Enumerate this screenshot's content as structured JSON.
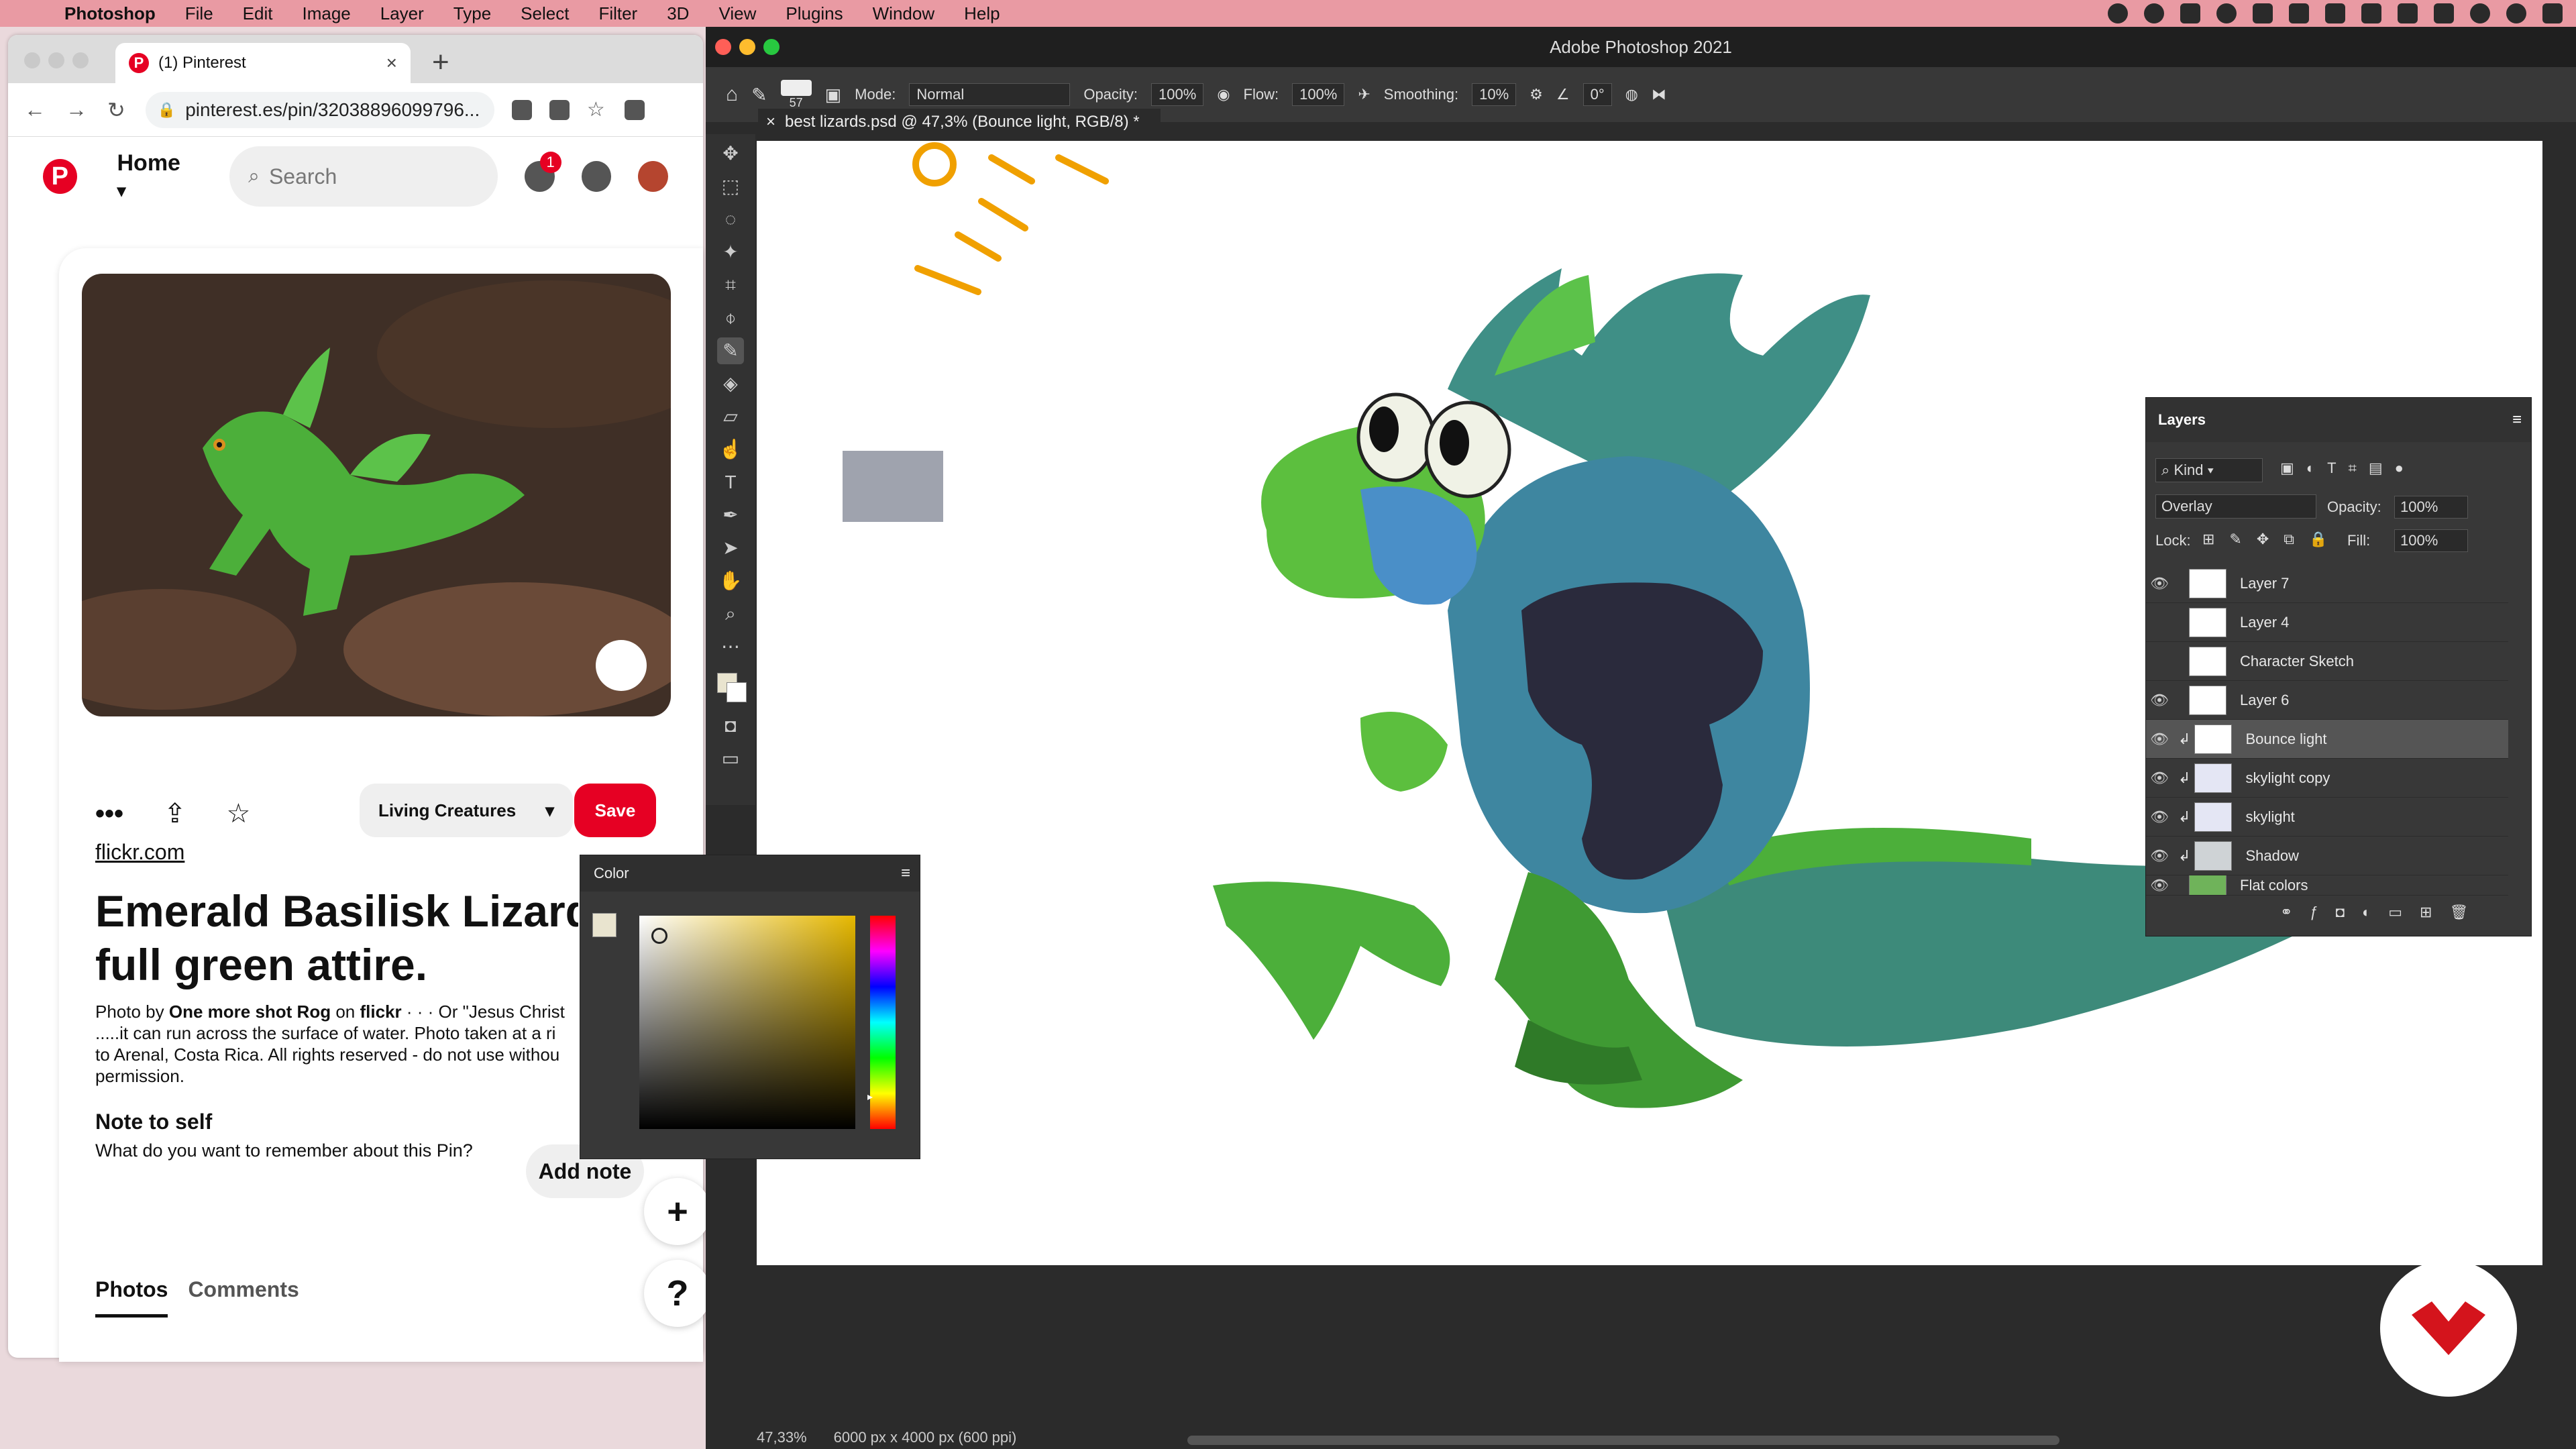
{
  "menubar": {
    "app": "Photoshop",
    "items": [
      "File",
      "Edit",
      "Image",
      "Layer",
      "Type",
      "Select",
      "Filter",
      "3D",
      "View",
      "Plugins",
      "Window",
      "Help"
    ]
  },
  "browser": {
    "tab_title": "(1) Pinterest",
    "url": "pinterest.es/pin/32038896099796..."
  },
  "pinterest": {
    "home_label": "Home",
    "search_placeholder": "Search",
    "notification_count": "1",
    "board_select": "Living Creatures",
    "save_label": "Save",
    "source_link": "flickr.com",
    "title": "Emerald Basilisk Lizard full green attire.",
    "title_line1": "Emerald Basilisk Lizard",
    "title_line2": "full green attire.",
    "desc_line1_a": "Photo by ",
    "desc_author": "One more shot Rog",
    "desc_line1_b": " on ",
    "desc_site": "flickr",
    "desc_line1_c": " · · · Or \"Jesus Christ",
    "desc_line2": ".....it can run across the surface of water. Photo taken at a ri",
    "desc_line3": "to Arenal, Costa Rica. All rights reserved - do not use withou",
    "desc_line4": "permission.",
    "note_heading": "Note to self",
    "note_prompt": "What do you want to remember about this Pin?",
    "add_note_label": "Add note",
    "tab_photos": "Photos",
    "tab_comments": "Comments",
    "fab_plus": "+",
    "fab_help": "?"
  },
  "photoshop": {
    "window_title": "Adobe Photoshop 2021",
    "options": {
      "brush_size": "57",
      "mode_label": "Mode:",
      "mode_value": "Normal",
      "opacity_label": "Opacity:",
      "opacity_value": "100%",
      "flow_label": "Flow:",
      "flow_value": "100%",
      "smoothing_label": "Smoothing:",
      "smoothing_value": "10%",
      "angle_value": "0°"
    },
    "doc_tab": "best lizards.psd @ 47,3% (Bounce light, RGB/8) *",
    "status_zoom": "47,33%",
    "status_doc": "6000 px x 4000 px (600 ppi)",
    "color_panel_title": "Color",
    "layers_panel": {
      "title": "Layers",
      "filter_kind": "Kind",
      "blend_mode": "Overlay",
      "opacity_label": "Opacity:",
      "opacity_value": "100%",
      "lock_label": "Lock:",
      "fill_label": "Fill:",
      "fill_value": "100%",
      "layers": [
        {
          "name": "Layer 7",
          "visible": true,
          "clipped": false,
          "selected": false
        },
        {
          "name": "Layer 4",
          "visible": false,
          "clipped": false,
          "selected": false
        },
        {
          "name": "Character Sketch",
          "visible": false,
          "clipped": false,
          "selected": false
        },
        {
          "name": "Layer 6",
          "visible": true,
          "clipped": false,
          "selected": false
        },
        {
          "name": "Bounce light",
          "visible": true,
          "clipped": true,
          "selected": true
        },
        {
          "name": "skylight copy",
          "visible": true,
          "clipped": true,
          "selected": false
        },
        {
          "name": "skylight",
          "visible": true,
          "clipped": true,
          "selected": false
        },
        {
          "name": "Shadow",
          "visible": true,
          "clipped": false,
          "selected": false
        },
        {
          "name": "Flat colors",
          "visible": true,
          "clipped": false,
          "selected": false
        }
      ]
    }
  },
  "colors": {
    "menubar_bg": "#e99aa3",
    "pinterest_red": "#e60023",
    "ps_dark": "#2b2b2b",
    "lizard_green": "#4caf3a"
  }
}
